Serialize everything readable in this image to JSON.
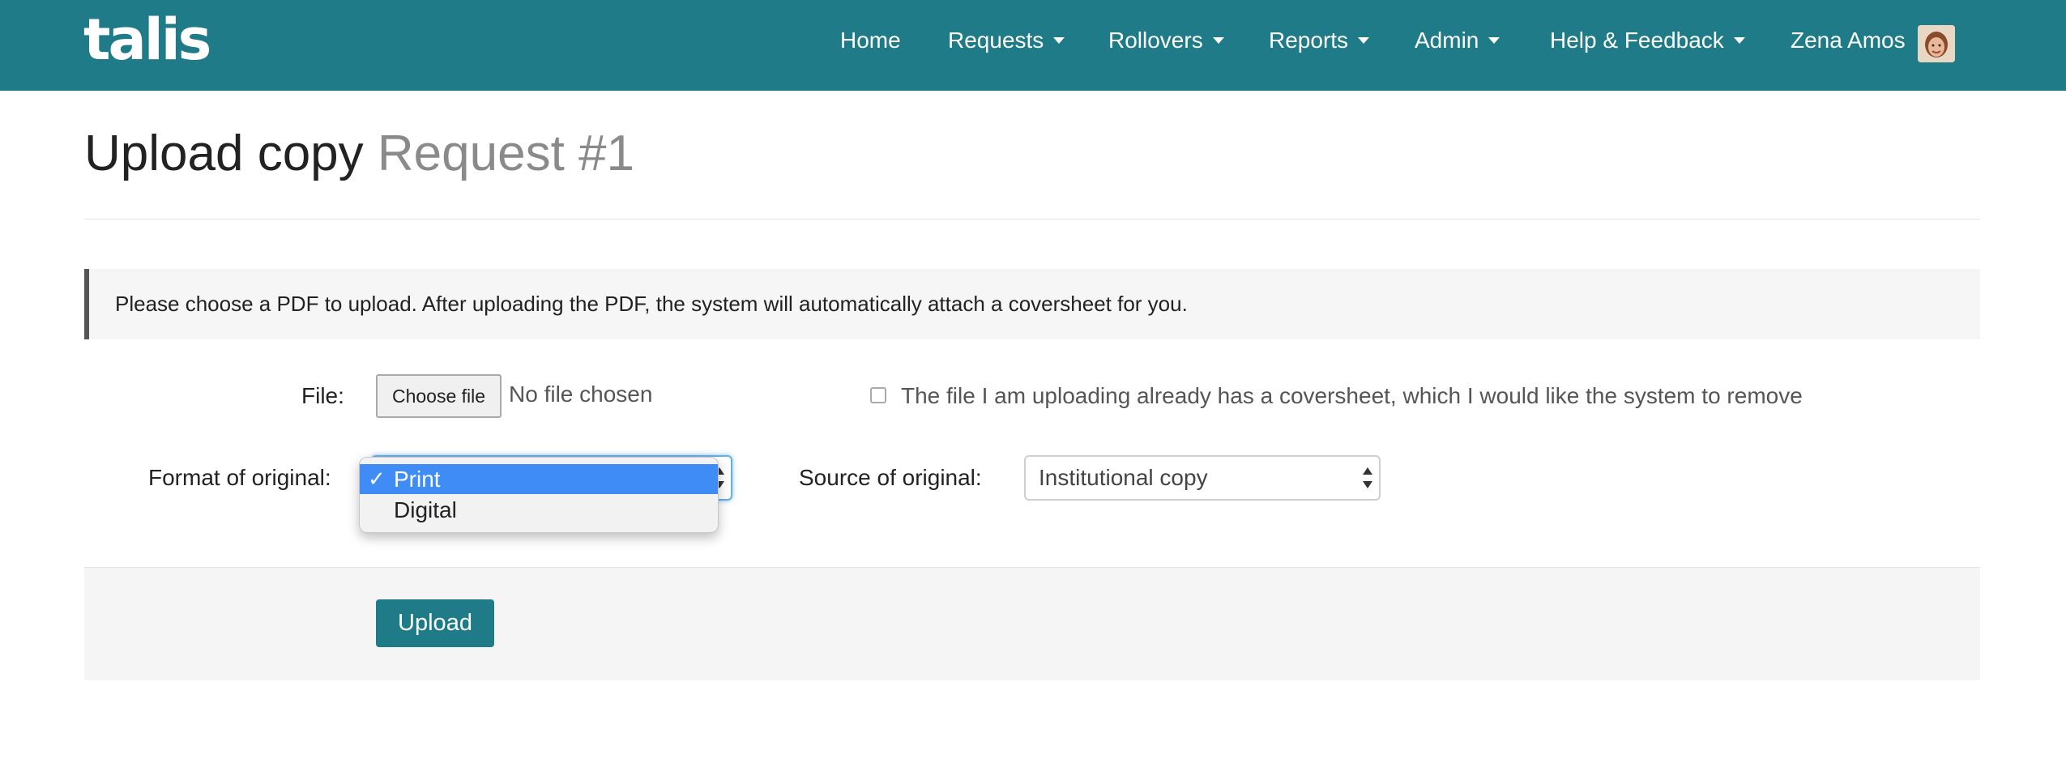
{
  "brand": {
    "logo_text": "talis",
    "primary_color": "#1e7b87"
  },
  "nav": {
    "home": "Home",
    "requests": "Requests",
    "rollovers": "Rollovers",
    "reports": "Reports",
    "admin": "Admin",
    "help": "Help & Feedback",
    "user_name": "Zena Amos"
  },
  "page": {
    "title": "Upload copy",
    "subtitle": "Request #1"
  },
  "info_message": "Please choose a PDF to upload. After uploading the PDF, the system will automatically attach a coversheet for you.",
  "form": {
    "file_label": "File:",
    "file_button": "Choose file",
    "file_status": "No file chosen",
    "remove_coversheet_label": "The file I am uploading already has a coversheet, which I would like the system to remove",
    "remove_coversheet_checked": false,
    "format_label": "Format of original:",
    "format_options": [
      "Print",
      "Digital"
    ],
    "format_selected": "Print",
    "format_check_glyph": "✓",
    "source_label": "Source of original:",
    "source_value": "Institutional copy",
    "upload_button": "Upload"
  }
}
